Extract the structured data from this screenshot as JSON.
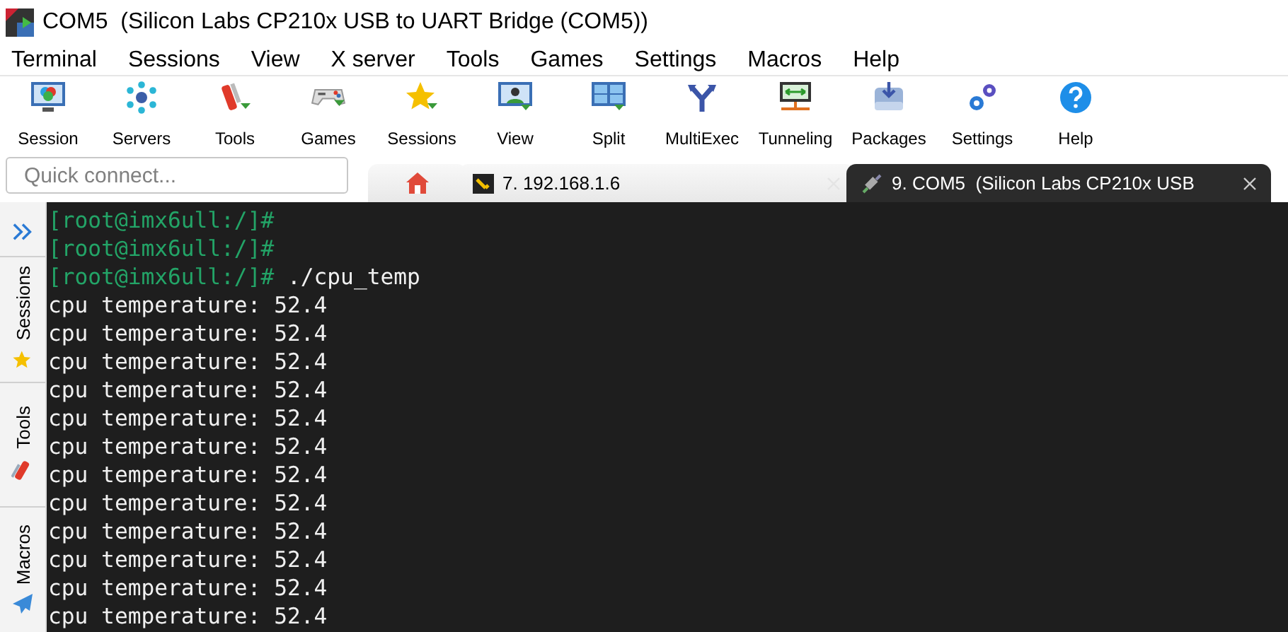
{
  "window": {
    "title": "COM5  (Silicon Labs CP210x USB to UART Bridge (COM5))"
  },
  "menu": [
    "Terminal",
    "Sessions",
    "View",
    "X server",
    "Tools",
    "Games",
    "Settings",
    "Macros",
    "Help"
  ],
  "toolbar": [
    "Session",
    "Servers",
    "Tools",
    "Games",
    "Sessions",
    "View",
    "Split",
    "MultiExec",
    "Tunneling",
    "Packages",
    "Settings",
    "Help"
  ],
  "quick_connect": {
    "placeholder": "Quick connect..."
  },
  "tabs": [
    {
      "kind": "home",
      "selected": false
    },
    {
      "kind": "ssh",
      "label": "7. 192.168.1.6",
      "selected": false
    },
    {
      "kind": "serial",
      "label": "9. COM5  (Silicon Labs CP210x USB",
      "selected": true
    }
  ],
  "side_tabs": [
    "Sessions",
    "Tools",
    "Macros"
  ],
  "terminal": [
    {
      "kind": "prompt",
      "prompt": "[root@imx6ull:/]#"
    },
    {
      "kind": "prompt",
      "prompt": "[root@imx6ull:/]#"
    },
    {
      "kind": "prompt",
      "prompt": "[root@imx6ull:/]#",
      "command": "./cpu_temp"
    },
    {
      "kind": "output",
      "text": "cpu temperature: 52.4"
    },
    {
      "kind": "output",
      "text": "cpu temperature: 52.4"
    },
    {
      "kind": "output",
      "text": "cpu temperature: 52.4"
    },
    {
      "kind": "output",
      "text": "cpu temperature: 52.4"
    },
    {
      "kind": "output",
      "text": "cpu temperature: 52.4"
    },
    {
      "kind": "output",
      "text": "cpu temperature: 52.4"
    },
    {
      "kind": "output",
      "text": "cpu temperature: 52.4"
    },
    {
      "kind": "output",
      "text": "cpu temperature: 52.4"
    },
    {
      "kind": "output",
      "text": "cpu temperature: 52.4"
    },
    {
      "kind": "output",
      "text": "cpu temperature: 52.4"
    },
    {
      "kind": "output",
      "text": "cpu temperature: 52.4"
    },
    {
      "kind": "output",
      "text": "cpu temperature: 52.4"
    }
  ]
}
